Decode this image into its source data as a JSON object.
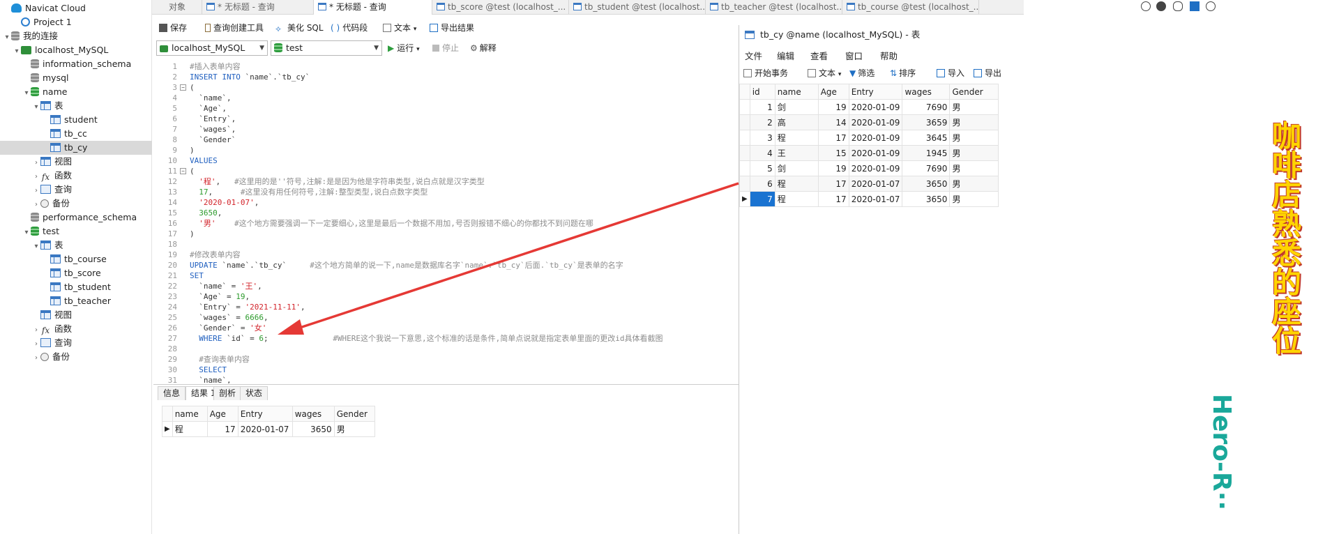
{
  "sidebar": {
    "items": [
      {
        "label": "Navicat Cloud",
        "icon": "cloud-icon",
        "level": 0,
        "toggle": ""
      },
      {
        "label": "Project 1",
        "icon": "project-icon",
        "level": 1,
        "toggle": ""
      },
      {
        "label": "我的连接",
        "icon": "connections-icon",
        "level": 0,
        "toggle": "▾"
      },
      {
        "label": "localhost_MySQL",
        "icon": "connection-icon",
        "level": 1,
        "toggle": "▾"
      },
      {
        "label": "information_schema",
        "icon": "database-icon",
        "level": 2,
        "toggle": ""
      },
      {
        "label": "mysql",
        "icon": "database-icon",
        "level": 2,
        "toggle": ""
      },
      {
        "label": "name",
        "icon": "database-open-icon",
        "level": 2,
        "toggle": "▾"
      },
      {
        "label": "表",
        "icon": "tables-icon",
        "level": 3,
        "toggle": "▾"
      },
      {
        "label": "student",
        "icon": "table-icon",
        "level": 4,
        "toggle": ""
      },
      {
        "label": "tb_cc",
        "icon": "table-icon",
        "level": 4,
        "toggle": ""
      },
      {
        "label": "tb_cy",
        "icon": "table-icon",
        "level": 4,
        "toggle": ""
      },
      {
        "label": "视图",
        "icon": "view-icon",
        "level": 3,
        "toggle": "›"
      },
      {
        "label": "函数",
        "icon": "function-icon",
        "level": 3,
        "toggle": "›"
      },
      {
        "label": "查询",
        "icon": "query-icon",
        "level": 3,
        "toggle": "›"
      },
      {
        "label": "备份",
        "icon": "backup-icon",
        "level": 3,
        "toggle": "›"
      },
      {
        "label": "performance_schema",
        "icon": "database-icon",
        "level": 2,
        "toggle": ""
      },
      {
        "label": "test",
        "icon": "database-open-icon",
        "level": 2,
        "toggle": "▾"
      },
      {
        "label": "表",
        "icon": "tables-icon",
        "level": 3,
        "toggle": "▾"
      },
      {
        "label": "tb_course",
        "icon": "table-icon",
        "level": 4,
        "toggle": ""
      },
      {
        "label": "tb_score",
        "icon": "table-icon",
        "level": 4,
        "toggle": ""
      },
      {
        "label": "tb_student",
        "icon": "table-icon",
        "level": 4,
        "toggle": ""
      },
      {
        "label": "tb_teacher",
        "icon": "table-icon",
        "level": 4,
        "toggle": ""
      },
      {
        "label": "视图",
        "icon": "view-icon",
        "level": 3,
        "toggle": ""
      },
      {
        "label": "函数",
        "icon": "function-icon",
        "level": 3,
        "toggle": "›"
      },
      {
        "label": "查询",
        "icon": "query-icon",
        "level": 3,
        "toggle": "›"
      },
      {
        "label": "备份",
        "icon": "backup-icon",
        "level": 3,
        "toggle": "›"
      }
    ],
    "selected_index": 10
  },
  "tabs": [
    {
      "label": "对象"
    },
    {
      "label": "* 无标题 - 查询"
    },
    {
      "label": "* 无标题 - 查询"
    },
    {
      "label": "tb_score @test (localhost_..."
    },
    {
      "label": "tb_student @test (localhost..."
    },
    {
      "label": "tb_teacher @test (localhost..."
    },
    {
      "label": "tb_course @test (localhost_..."
    }
  ],
  "query_toolbar": {
    "save": "保存",
    "query_builder": "查询创建工具",
    "beautify": "美化 SQL",
    "code_snippet": "代码段",
    "text": "文本",
    "export": "导出结果"
  },
  "connection_bar": {
    "connection": "localhost_MySQL",
    "database": "test",
    "run": "运行",
    "stop": "停止",
    "explain": "解释"
  },
  "editor_lines": [
    [
      [
        "cm",
        "#插入表单内容"
      ]
    ],
    [
      [
        "kw",
        "INSERT INTO "
      ],
      [
        "pl",
        "`name`.`tb_cy`"
      ]
    ],
    [
      [
        "pl",
        "("
      ]
    ],
    [
      [
        "pl",
        "  `name`,"
      ]
    ],
    [
      [
        "pl",
        "  `Age`,"
      ]
    ],
    [
      [
        "pl",
        "  `Entry`,"
      ]
    ],
    [
      [
        "pl",
        "  `wages`,"
      ]
    ],
    [
      [
        "pl",
        "  `Gender`"
      ]
    ],
    [
      [
        "pl",
        ")"
      ]
    ],
    [
      [
        "kw",
        "VALUES"
      ]
    ],
    [
      [
        "pl",
        "("
      ]
    ],
    [
      [
        "str",
        "  '程'"
      ],
      [
        "pl",
        ",   "
      ],
      [
        "cm",
        "#这里用的是''符号,注解:是是因为他是字符串类型,说白点就是汉字类型"
      ]
    ],
    [
      [
        "num",
        "  17"
      ],
      [
        "pl",
        ",      "
      ],
      [
        "cm",
        "#这里没有用任何符号,注解:整型类型,说白点数字类型"
      ]
    ],
    [
      [
        "str",
        "  '2020-01-07'"
      ],
      [
        "pl",
        ","
      ]
    ],
    [
      [
        "num",
        "  3650"
      ],
      [
        "pl",
        ","
      ]
    ],
    [
      [
        "str",
        "  '男'"
      ],
      [
        "pl",
        "    "
      ],
      [
        "cm",
        "#这个地方需要强调一下一定要细心,这里是最后一个数据不用加,号否则报错不细心的你都找不到问题在哪"
      ]
    ],
    [
      [
        "pl",
        ")"
      ]
    ],
    [
      [
        "pl",
        ""
      ]
    ],
    [
      [
        "cm",
        "#修改表单内容"
      ]
    ],
    [
      [
        "kw",
        "UPDATE "
      ],
      [
        "pl",
        "`name`.`tb_cy`     "
      ],
      [
        "cm",
        "#这个地方简单的说一下,name是数据库名字`name`.`tb_cy`后面.`tb_cy`是表单的名字"
      ]
    ],
    [
      [
        "kw",
        "SET"
      ]
    ],
    [
      [
        "pl",
        "  `name` = "
      ],
      [
        "str",
        "'王'"
      ],
      [
        "pl",
        ","
      ]
    ],
    [
      [
        "pl",
        "  `Age` = "
      ],
      [
        "num",
        "19"
      ],
      [
        "pl",
        ","
      ]
    ],
    [
      [
        "pl",
        "  `Entry` = "
      ],
      [
        "str",
        "'2021-11-11'"
      ],
      [
        "pl",
        ","
      ]
    ],
    [
      [
        "pl",
        "  `wages` = "
      ],
      [
        "num",
        "6666"
      ],
      [
        "pl",
        ","
      ]
    ],
    [
      [
        "pl",
        "  `Gender` = "
      ],
      [
        "str",
        "'女'"
      ]
    ],
    [
      [
        "kw",
        "  WHERE "
      ],
      [
        "pl",
        "`id` = "
      ],
      [
        "num",
        "6"
      ],
      [
        "pl",
        ";              "
      ],
      [
        "cm",
        "#WHERE这个我说一下意思,这个标准的话是条件,简单点说就是指定表单里面的更改id具体看截图"
      ]
    ],
    [
      [
        "pl",
        ""
      ]
    ],
    [
      [
        "cm",
        "  #查询表单内容"
      ]
    ],
    [
      [
        "kw",
        "  SELECT"
      ]
    ],
    [
      [
        "pl",
        "  `name`,"
      ]
    ]
  ],
  "result_tabs": [
    "信息",
    "结果 1",
    "剖析",
    "状态"
  ],
  "result_grid": {
    "headers": [
      "name",
      "Age",
      "Entry",
      "wages",
      "Gender"
    ],
    "rows": [
      [
        "程",
        "17",
        "2020-01-07",
        "3650",
        "男"
      ]
    ]
  },
  "table_window": {
    "title": "tb_cy @name (localhost_MySQL) - 表",
    "menu": [
      "文件",
      "编辑",
      "查看",
      "窗口",
      "帮助"
    ],
    "toolbar": {
      "begin": "开始事务",
      "text": "文本",
      "filter": "筛选",
      "sort": "排序",
      "import": "导入",
      "export": "导出"
    },
    "headers": [
      "id",
      "name",
      "Age",
      "Entry",
      "wages",
      "Gender"
    ],
    "rows": [
      [
        "1",
        "剑",
        "19",
        "2020-01-09",
        "7690",
        "男"
      ],
      [
        "2",
        "高",
        "14",
        "2020-01-09",
        "3659",
        "男"
      ],
      [
        "3",
        "程",
        "17",
        "2020-01-09",
        "3645",
        "男"
      ],
      [
        "4",
        "王",
        "15",
        "2020-01-09",
        "1945",
        "男"
      ],
      [
        "5",
        "剑",
        "19",
        "2020-01-09",
        "7690",
        "男"
      ],
      [
        "6",
        "程",
        "17",
        "2020-01-07",
        "3650",
        "男"
      ],
      [
        "7",
        "程",
        "17",
        "2020-01-07",
        "3650",
        "男"
      ]
    ],
    "selected_row": 6
  },
  "overlay": {
    "vertical_text": "咖啡店熟悉的座位",
    "watermark": "Hero-R··"
  },
  "colors": {
    "accent": "#1a73d1",
    "annotation_arrow": "#e53935"
  }
}
